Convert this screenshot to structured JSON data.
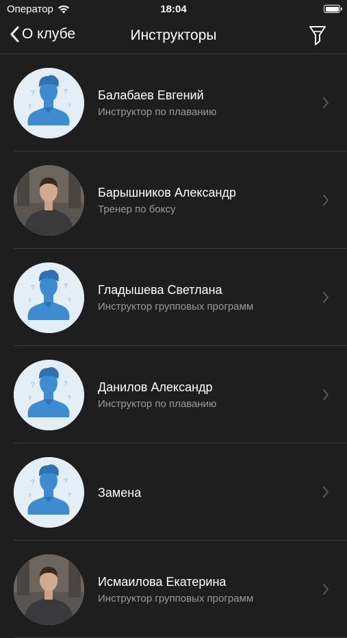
{
  "status_bar": {
    "carrier": "Оператор",
    "time": "18:04"
  },
  "nav": {
    "back_label": "О клубе",
    "title": "Инструкторы"
  },
  "instructors": [
    {
      "name": "Балабаев Евгений",
      "role": "Инструктор по плаванию",
      "photo": "placeholder"
    },
    {
      "name": "Барышников Александр",
      "role": "Тренер по боксу",
      "photo": "photo"
    },
    {
      "name": "Гладышева Светлана",
      "role": "Инструктор групповых программ",
      "photo": "placeholder"
    },
    {
      "name": "Данилов Александр",
      "role": "Инструктор по плаванию",
      "photo": "placeholder"
    },
    {
      "name": "Замена",
      "role": "",
      "photo": "placeholder"
    },
    {
      "name": "Исмаилова Екатерина",
      "role": "Инструктор групповых программ",
      "photo": "photo"
    }
  ],
  "colors": {
    "background": "#1e1e1e",
    "separator": "#3a3a3a",
    "secondary_text": "#9a9a9a",
    "avatar_blue": "#3e8bd0"
  }
}
